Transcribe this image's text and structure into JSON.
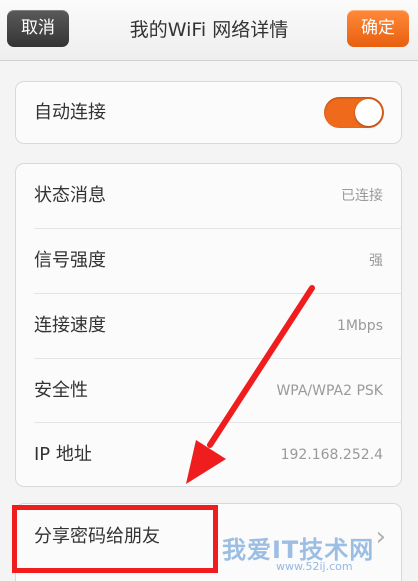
{
  "header": {
    "cancel_label": "取消",
    "title": "我的WiFi 网络详情",
    "confirm_label": "确定"
  },
  "auto_connect": {
    "label": "自动连接",
    "enabled": true
  },
  "details": [
    {
      "label": "状态消息",
      "value": "已连接"
    },
    {
      "label": "信号强度",
      "value": "强"
    },
    {
      "label": "连接速度",
      "value": "1Mbps"
    },
    {
      "label": "安全性",
      "value": "WPA/WPA2 PSK"
    },
    {
      "label": "IP 地址",
      "value": "192.168.252.4"
    }
  ],
  "share": {
    "label": "分享密码给朋友"
  },
  "annotation": {
    "arrow_color": "#ef1d1d",
    "box_color": "#ef1d1d"
  },
  "watermark": {
    "text": "我爱IT技术网",
    "url": "www.52ij.com"
  },
  "colors": {
    "accent": "#f06a1c",
    "cancel_bg": "#3f3f3f"
  }
}
